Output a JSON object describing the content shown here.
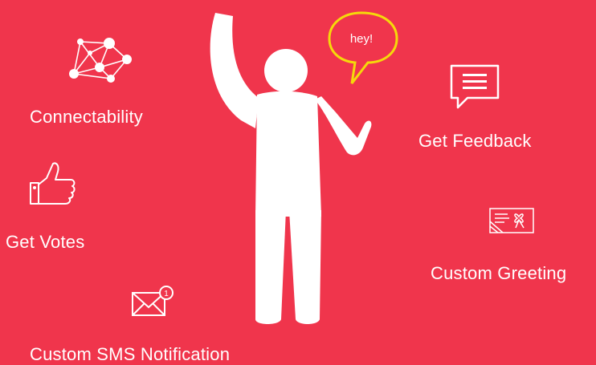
{
  "features": {
    "connectability": {
      "label": "Connectability",
      "icon": "network-icon"
    },
    "get_votes": {
      "label": "Get Votes",
      "icon": "thumbs-up-icon"
    },
    "custom_sms": {
      "label": "Custom SMS Notification",
      "icon": "envelope-notification-icon"
    },
    "get_feedback": {
      "label": "Get Feedback",
      "icon": "chat-bubble-icon"
    },
    "custom_greeting": {
      "label": "Custom Greeting",
      "icon": "greeting-card-icon"
    }
  },
  "speech_bubble": {
    "text": "hey!",
    "border_color": "#f5d90a"
  },
  "colors": {
    "background": "#f0354c",
    "foreground": "#ffffff",
    "accent": "#f5d90a"
  }
}
